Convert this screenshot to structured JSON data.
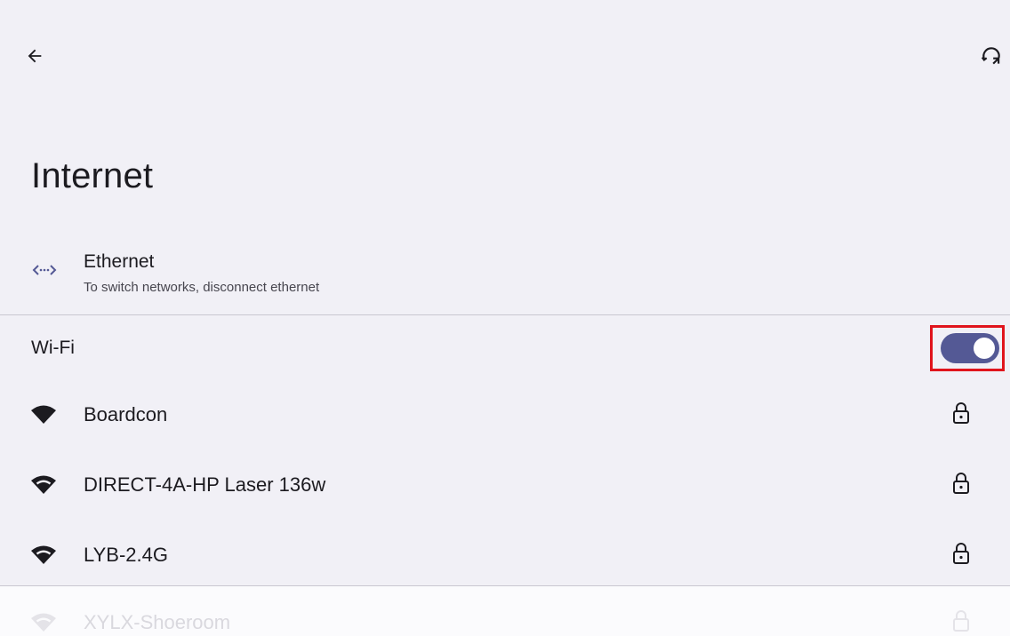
{
  "header": {
    "back_icon": "arrow-back-icon",
    "refresh_icon": "refresh-icon",
    "title": "Internet"
  },
  "ethernet": {
    "icon": "ethernet-icon",
    "title": "Ethernet",
    "subtitle": "To switch networks, disconnect ethernet"
  },
  "wifi": {
    "label": "Wi-Fi",
    "enabled": true,
    "toggle_color": "#545995",
    "highlight_color": "#e0141c"
  },
  "networks": [
    {
      "name": "Boardcon",
      "signal": "full",
      "secured": true,
      "signal_icon": "wifi-signal-full-icon",
      "lock_icon": "lock-icon"
    },
    {
      "name": "DIRECT-4A-HP Laser 136w",
      "signal": "strong",
      "secured": true,
      "signal_icon": "wifi-signal-icon",
      "lock_icon": "lock-icon"
    },
    {
      "name": "LYB-2.4G",
      "signal": "strong",
      "secured": true,
      "signal_icon": "wifi-signal-icon",
      "lock_icon": "lock-icon"
    },
    {
      "name": "XYLX-Shoeroom",
      "signal": "strong",
      "secured": true,
      "signal_icon": "wifi-signal-icon",
      "lock_icon": "lock-icon"
    }
  ],
  "colors": {
    "background": "#f1f0f6",
    "accent": "#545995",
    "divider": "#c9c7d0"
  }
}
